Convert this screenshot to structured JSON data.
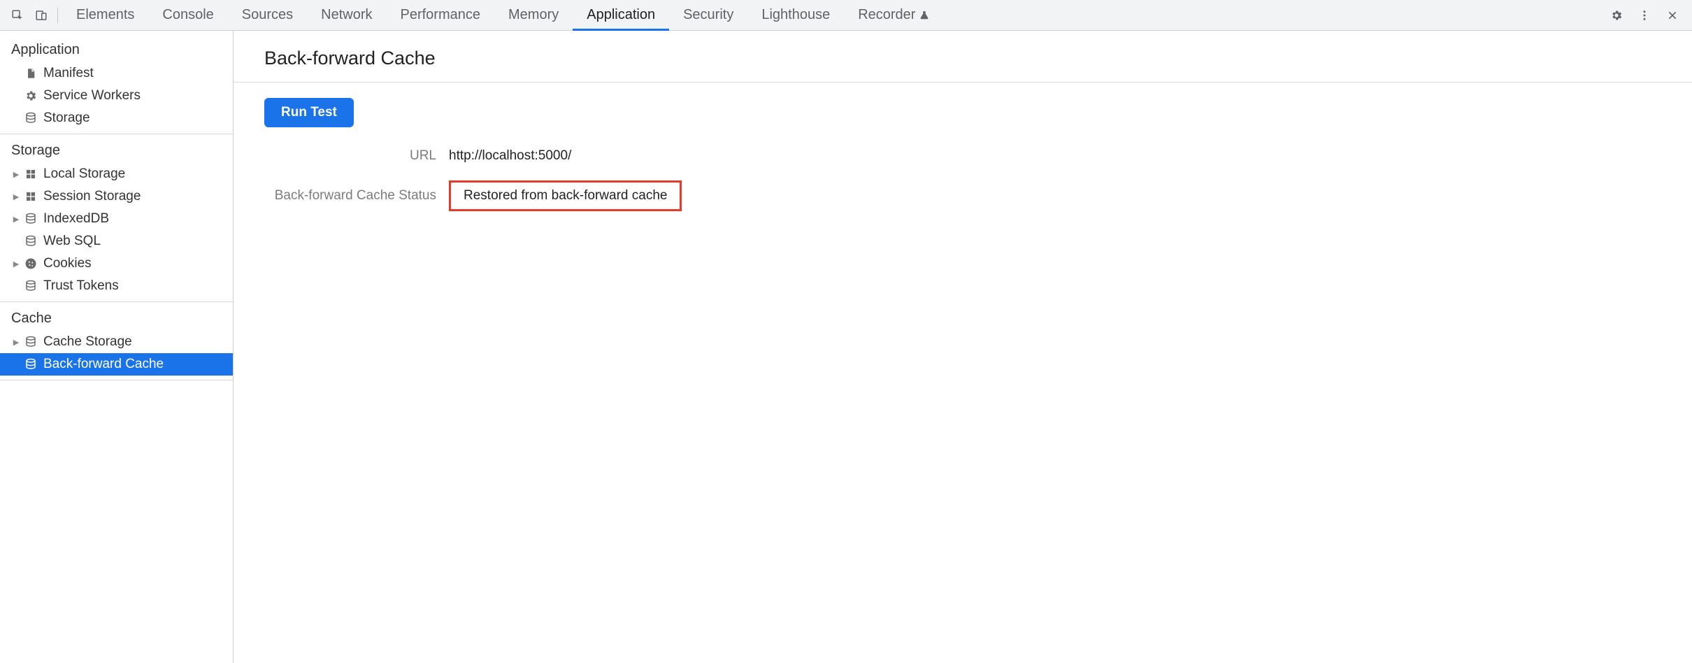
{
  "tabs": {
    "items": [
      {
        "label": "Elements",
        "active": false
      },
      {
        "label": "Console",
        "active": false
      },
      {
        "label": "Sources",
        "active": false
      },
      {
        "label": "Network",
        "active": false
      },
      {
        "label": "Performance",
        "active": false
      },
      {
        "label": "Memory",
        "active": false
      },
      {
        "label": "Application",
        "active": true
      },
      {
        "label": "Security",
        "active": false
      },
      {
        "label": "Lighthouse",
        "active": false
      },
      {
        "label": "Recorder",
        "active": false,
        "experimental": true
      }
    ]
  },
  "sidebar": {
    "groups": [
      {
        "title": "Application",
        "items": [
          {
            "label": "Manifest",
            "icon": "file",
            "expandable": false
          },
          {
            "label": "Service Workers",
            "icon": "gear",
            "expandable": false
          },
          {
            "label": "Storage",
            "icon": "db",
            "expandable": false
          }
        ]
      },
      {
        "title": "Storage",
        "items": [
          {
            "label": "Local Storage",
            "icon": "grid",
            "expandable": true
          },
          {
            "label": "Session Storage",
            "icon": "grid",
            "expandable": true
          },
          {
            "label": "IndexedDB",
            "icon": "db",
            "expandable": true
          },
          {
            "label": "Web SQL",
            "icon": "db",
            "expandable": false
          },
          {
            "label": "Cookies",
            "icon": "cookie",
            "expandable": true
          },
          {
            "label": "Trust Tokens",
            "icon": "db",
            "expandable": false
          }
        ]
      },
      {
        "title": "Cache",
        "items": [
          {
            "label": "Cache Storage",
            "icon": "db",
            "expandable": true
          },
          {
            "label": "Back-forward Cache",
            "icon": "db",
            "expandable": false,
            "selected": true
          }
        ]
      }
    ]
  },
  "content": {
    "title": "Back-forward Cache",
    "run_button": "Run Test",
    "url_label": "URL",
    "url_value": "http://localhost:5000/",
    "status_label": "Back-forward Cache Status",
    "status_value": "Restored from back-forward cache"
  }
}
